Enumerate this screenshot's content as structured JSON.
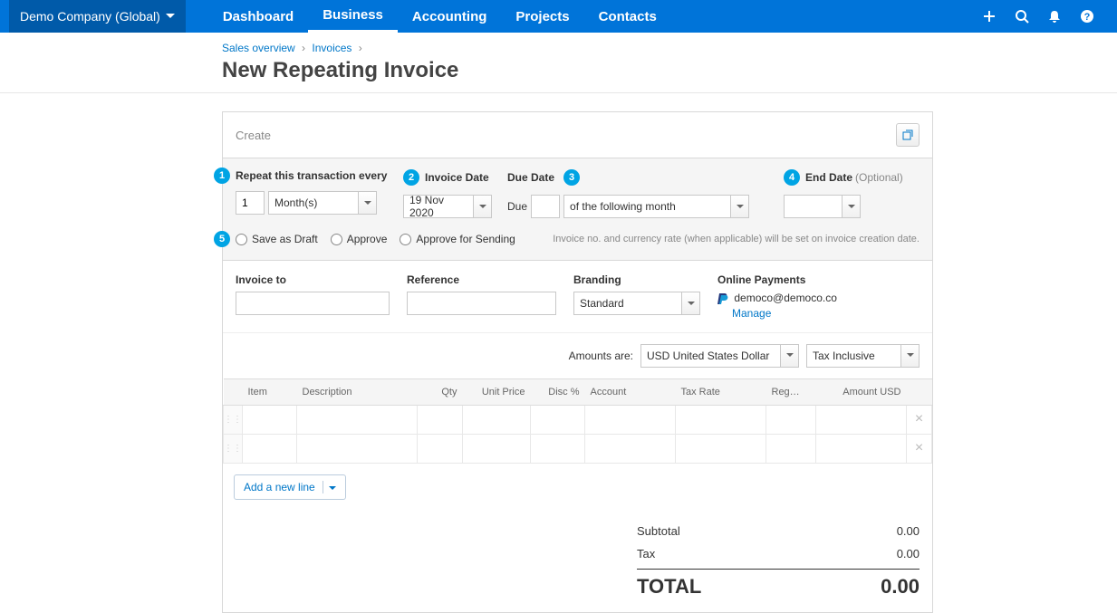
{
  "nav": {
    "org": "Demo Company (Global)",
    "items": [
      "Dashboard",
      "Business",
      "Accounting",
      "Projects",
      "Contacts"
    ]
  },
  "breadcrumb": {
    "sales_overview": "Sales overview",
    "invoices": "Invoices"
  },
  "page_title": "New Repeating Invoice",
  "panel": {
    "create": "Create"
  },
  "repeat": {
    "label_every": "Repeat this transaction every",
    "every_value": "1",
    "every_unit": "Month(s)",
    "label_invoice_date": "Invoice Date",
    "invoice_date": "19 Nov 2020",
    "label_due_date": "Due Date",
    "due_prefix": "Due",
    "due_value": "",
    "due_option": "of the following month",
    "label_end_date": "End Date",
    "end_optional": "(Optional)",
    "end_date": ""
  },
  "radios": {
    "draft": "Save as Draft",
    "approve": "Approve",
    "approve_send": "Approve for Sending",
    "note": "Invoice no. and currency rate (when applicable) will be set on invoice creation date."
  },
  "details": {
    "invoice_to_label": "Invoice to",
    "reference_label": "Reference",
    "branding_label": "Branding",
    "branding_value": "Standard",
    "online_payments_label": "Online Payments",
    "payment_email": "democo@democo.co",
    "manage": "Manage"
  },
  "amounts": {
    "label": "Amounts are:",
    "currency": "USD United States Dollar",
    "tax": "Tax Inclusive"
  },
  "columns": {
    "item": "Item",
    "description": "Description",
    "qty": "Qty",
    "unit_price": "Unit Price",
    "disc": "Disc %",
    "account": "Account",
    "tax_rate": "Tax Rate",
    "region": "Reg…",
    "amount": "Amount USD"
  },
  "add_line": "Add a new line",
  "totals": {
    "subtotal_label": "Subtotal",
    "subtotal_value": "0.00",
    "tax_label": "Tax",
    "tax_value": "0.00",
    "total_label": "TOTAL",
    "total_value": "0.00"
  }
}
